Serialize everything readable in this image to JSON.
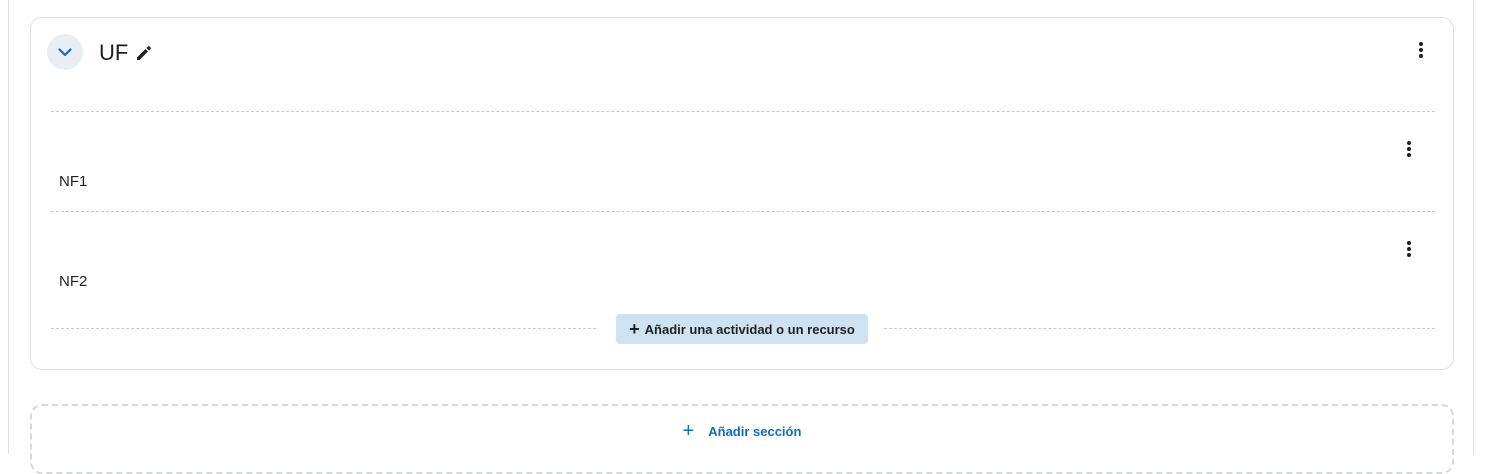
{
  "section": {
    "title": "UF",
    "collapse_icon": "chevron-down-icon",
    "edit_icon": "pencil-icon",
    "menu_icon": "kebab-menu-icon"
  },
  "activities": [
    {
      "name": "NF1"
    },
    {
      "name": "NF2"
    }
  ],
  "add_activity": {
    "plus": "+",
    "label": "Añadir una actividad o un recurso"
  },
  "add_section": {
    "plus": "+",
    "label": "Añadir sección"
  },
  "colors": {
    "accent": "#0f6cbf",
    "add_activity_bg": "#cfe2f1",
    "collapse_bg": "#e8eef4",
    "border": "#dee2e6"
  }
}
